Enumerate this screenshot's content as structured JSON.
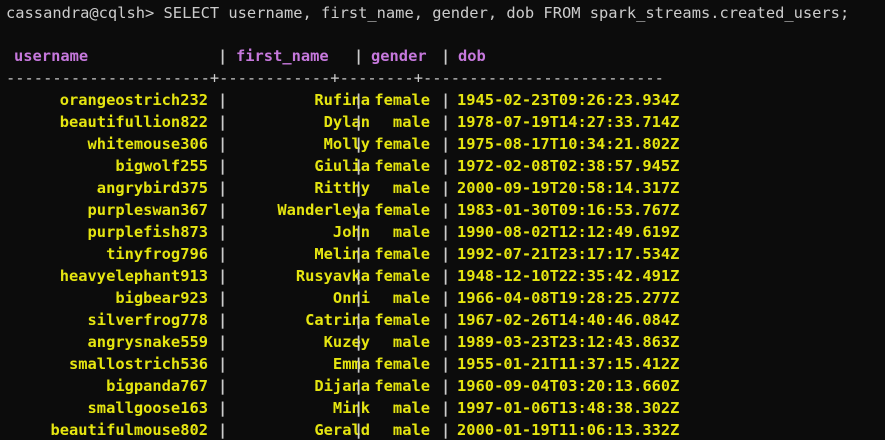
{
  "window": {
    "prompt": "cassandra@cqlsh>",
    "command": " SELECT username, first_name, gender, dob FROM spark_streams.created_users;"
  },
  "table": {
    "columns": [
      "username",
      "first_name",
      "gender",
      "dob"
    ],
    "divider": "----------------------+------------+--------+--------------------------",
    "rows": [
      [
        "orangeostrich232",
        "Rufina",
        "female",
        "1945-02-23T09:26:23.934Z"
      ],
      [
        "beautifullion822",
        "Dylan",
        "male",
        "1978-07-19T14:27:33.714Z"
      ],
      [
        "whitemouse306",
        "Molly",
        "female",
        "1975-08-17T10:34:21.802Z"
      ],
      [
        "bigwolf255",
        "Giulia",
        "female",
        "1972-02-08T02:38:57.945Z"
      ],
      [
        "angrybird375",
        "Ritthy",
        "male",
        "2000-09-19T20:58:14.317Z"
      ],
      [
        "purpleswan367",
        "Wanderleya",
        "female",
        "1983-01-30T09:16:53.767Z"
      ],
      [
        "purplefish873",
        "John",
        "male",
        "1990-08-02T12:12:49.619Z"
      ],
      [
        "tinyfrog796",
        "Melina",
        "female",
        "1992-07-21T23:17:17.534Z"
      ],
      [
        "heavyelephant913",
        "Rusyavka",
        "female",
        "1948-12-10T22:35:42.491Z"
      ],
      [
        "bigbear923",
        "Onni",
        "male",
        "1966-04-08T19:28:25.277Z"
      ],
      [
        "silverfrog778",
        "Catrina",
        "female",
        "1967-02-26T14:40:46.084Z"
      ],
      [
        "angrysnake559",
        "Kuzey",
        "male",
        "1989-03-23T23:12:43.863Z"
      ],
      [
        "smallostrich536",
        "Emma",
        "female",
        "1955-01-21T11:37:15.412Z"
      ],
      [
        "bigpanda767",
        "Dijana",
        "female",
        "1960-09-04T03:20:13.660Z"
      ],
      [
        "smallgoose163",
        "Mink",
        "male",
        "1997-01-06T13:48:38.302Z"
      ],
      [
        "beautifulmouse802",
        "Gerald",
        "male",
        "2000-01-19T11:06:13.332Z"
      ]
    ]
  },
  "colors": {
    "background": "#0c0c0c",
    "header": "#c678dd",
    "value": "#e5e510",
    "text": "#cccccc"
  }
}
